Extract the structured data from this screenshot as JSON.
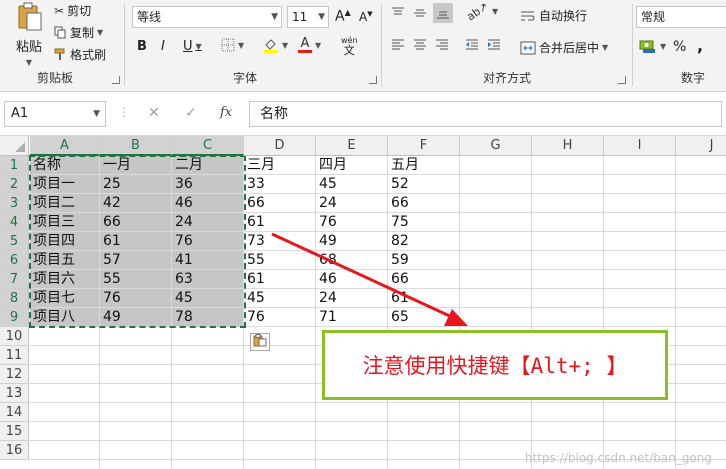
{
  "ribbon": {
    "clipboard": {
      "paste_label": "粘贴",
      "cut_label": "剪切",
      "copy_label": "复制",
      "format_painter_label": "格式刷",
      "group_label": "剪贴板"
    },
    "font": {
      "font_name": "等线",
      "font_size": "11",
      "bold": "B",
      "italic": "I",
      "underline": "U",
      "phonetic": "wén",
      "group_label": "字体"
    },
    "alignment": {
      "wrap_text_label": "自动换行",
      "merge_center_label": "合并后居中",
      "group_label": "对齐方式"
    },
    "number": {
      "format_value": "常规",
      "percent": "%",
      "comma": ",",
      "group_label": "数字"
    }
  },
  "formula_bar": {
    "name_box": "A1",
    "cancel": "✕",
    "enter": "✓",
    "fx": "fx",
    "value": "名称"
  },
  "sheet": {
    "columns": [
      "A",
      "B",
      "C",
      "D",
      "E",
      "F",
      "G",
      "H",
      "I",
      "J"
    ],
    "rows": [
      "1",
      "2",
      "3",
      "4",
      "5",
      "6",
      "7",
      "8",
      "9",
      "10",
      "11",
      "12",
      "13",
      "14",
      "15",
      "16"
    ],
    "cells": [
      [
        "名称",
        "一月",
        "二月",
        "三月",
        "四月",
        "五月"
      ],
      [
        "项目一",
        "25",
        "36",
        "33",
        "45",
        "52"
      ],
      [
        "项目二",
        "42",
        "46",
        "66",
        "24",
        "66"
      ],
      [
        "项目三",
        "66",
        "24",
        "61",
        "76",
        "75"
      ],
      [
        "项目四",
        "61",
        "76",
        "73",
        "49",
        "82"
      ],
      [
        "项目五",
        "57",
        "41",
        "55",
        "68",
        "59"
      ],
      [
        "项目六",
        "55",
        "63",
        "61",
        "46",
        "66"
      ],
      [
        "项目七",
        "76",
        "45",
        "45",
        "24",
        "61"
      ],
      [
        "项目八",
        "49",
        "78",
        "76",
        "71",
        "65"
      ]
    ],
    "selected_range": "A1:C9"
  },
  "annotation": {
    "text": "注意使用快捷键【Alt+; 】",
    "border_color": "#8cbf26",
    "text_color": "#e8171f",
    "arrow_color": "#e8171f"
  },
  "watermark": "https://blog.csdn.net/ban_gong",
  "colors": {
    "accent": "#217346",
    "selection_fill": "#c6c6c6"
  }
}
